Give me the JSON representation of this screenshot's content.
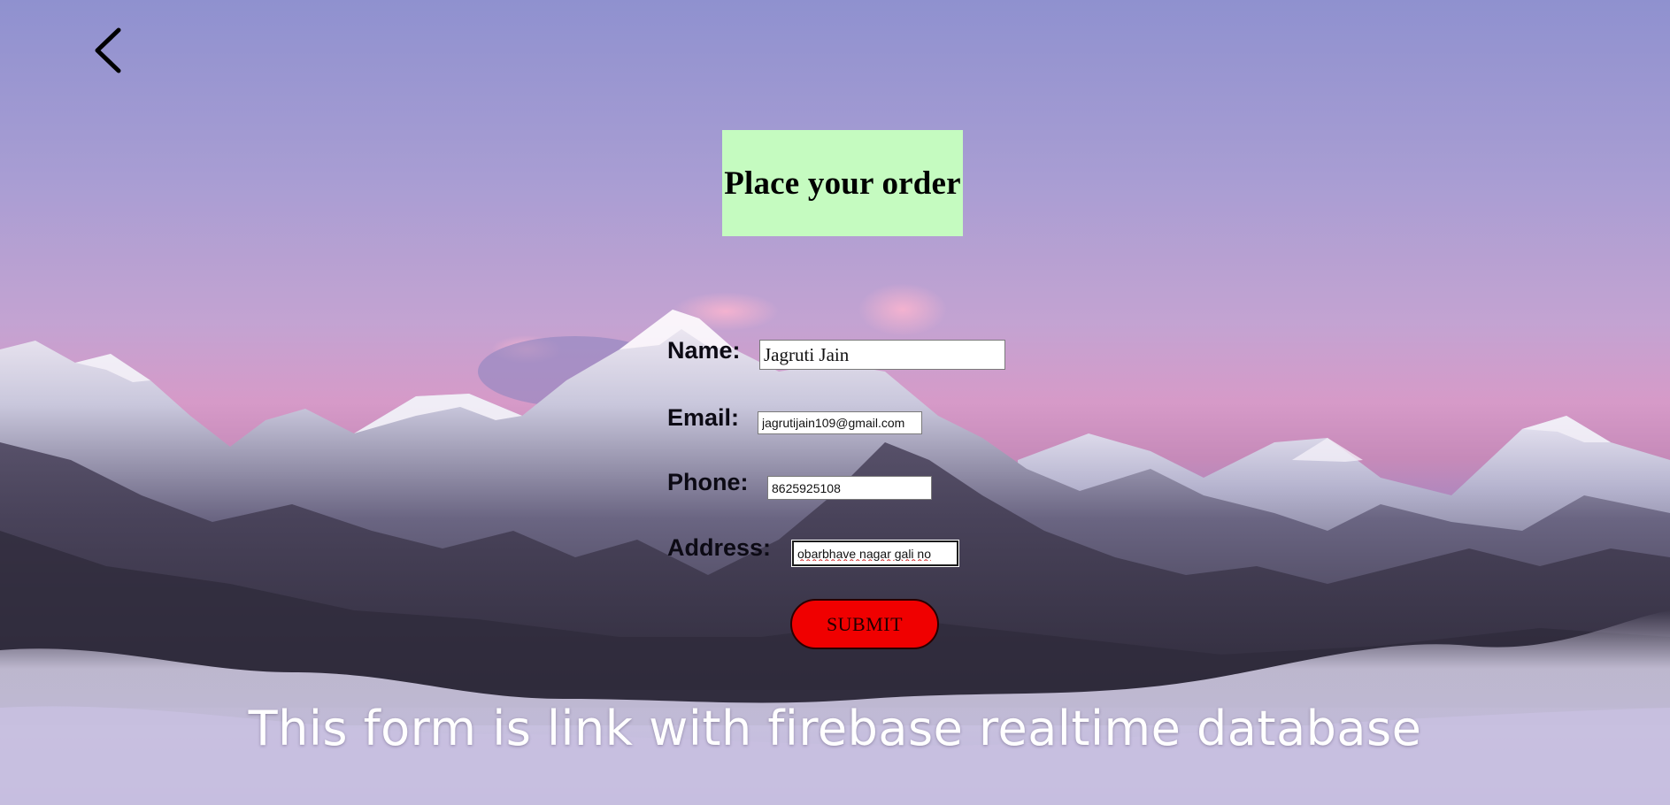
{
  "nav": {
    "back_icon": "chevron-left-icon"
  },
  "header": {
    "title": "Place your order",
    "title_bg": "#c5fbc0"
  },
  "form": {
    "name": {
      "label": "Name:",
      "value": "Jagruti Jain"
    },
    "email": {
      "label": "Email:",
      "value": "jagrutijain109@gmail.com"
    },
    "phone": {
      "label": "Phone:",
      "value": "8625925108"
    },
    "address": {
      "label": "Address:",
      "value": "obarbhave nagar gali no"
    },
    "submit_label": "SUBMIT",
    "submit_color": "#f00000"
  },
  "caption": "This form is link with firebase realtime database"
}
